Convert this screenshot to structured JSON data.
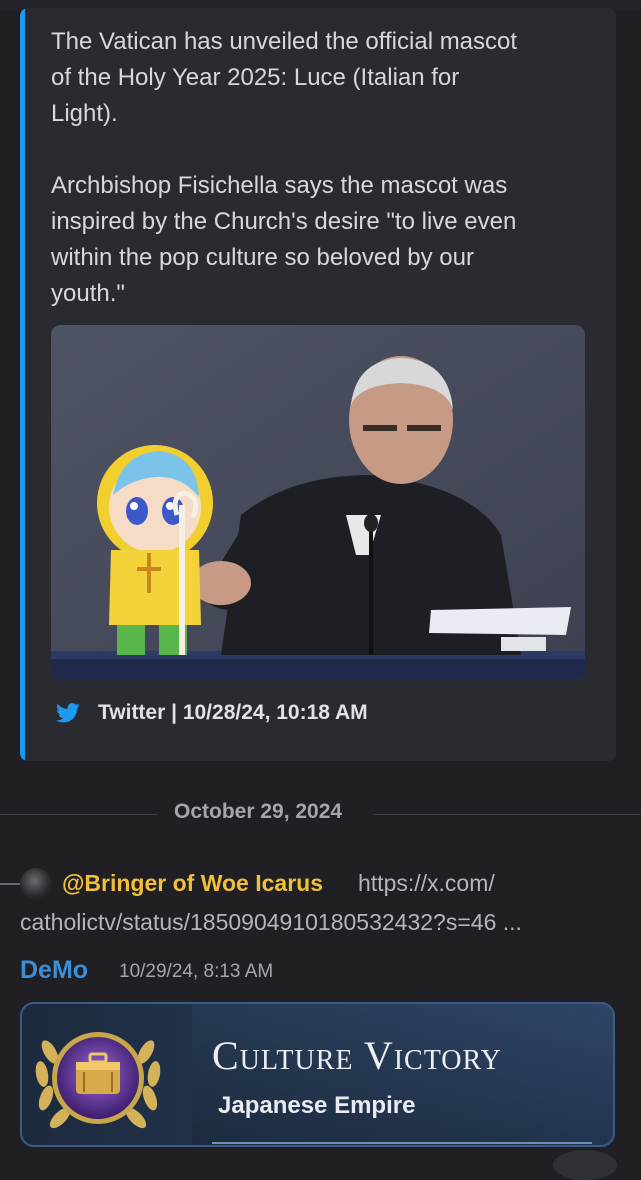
{
  "embed": {
    "paragraph1": "The Vatican has unveiled the official mascot\nof the Holy Year 2025: Luce (Italian for\nLight).",
    "paragraph2": "Archbishop Fisichella says the mascot was\ninspired by the Church's desire \"to live even\nwithin the pop culture so beloved by our\nyouth.\"",
    "footer": "Twitter | 10/28/24, 10:18 AM",
    "accent_color": "#1e9bf0",
    "icon": "twitter-bird-icon"
  },
  "date_divider": "October 29, 2024",
  "reply": {
    "mention": "@Bringer of Woe Icarus",
    "url_line1": "https://x.com/",
    "url_line2": "catholictv/status/1850904910180532432?s=46 ..."
  },
  "message": {
    "author": "DeMo",
    "timestamp": "10/29/24, 8:13 AM",
    "author_color": "#3a8fd8"
  },
  "banner": {
    "title": "Culture Victory",
    "subtitle": "Japanese Empire"
  }
}
